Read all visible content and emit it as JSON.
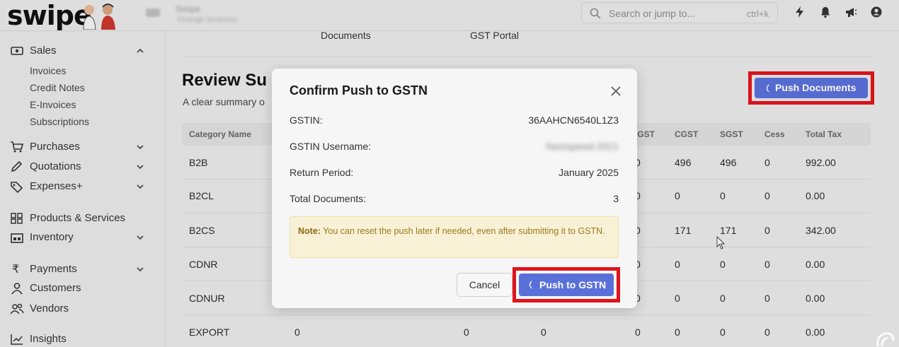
{
  "brand": {
    "logo_text": "swipe"
  },
  "topbar": {
    "company_name": "Swipe",
    "company_sub": "Change business",
    "search_placeholder": "Search or jump to...",
    "search_shortcut": "ctrl+k",
    "icons": [
      "lightning-icon",
      "bell-icon",
      "megaphone-icon",
      "user-circle-icon"
    ]
  },
  "sidebar": {
    "sales": "Sales",
    "sales_items": [
      "Invoices",
      "Credit Notes",
      "E-Invoices",
      "Subscriptions"
    ],
    "purchases": "Purchases",
    "quotations": "Quotations",
    "expenses": "Expenses+",
    "products": "Products & Services",
    "inventory": "Inventory",
    "payments": "Payments",
    "customers": "Customers",
    "vendors": "Vendors",
    "insights": "Insights"
  },
  "main": {
    "tabs": [
      "Documents",
      "GST Portal"
    ],
    "title": "Review Su",
    "subtitle": "A clear summary o",
    "push_documents_label": "Push Documents",
    "table": {
      "headers": [
        "Category Name",
        "IGST",
        "CGST",
        "SGST",
        "Cess",
        "Total Tax"
      ],
      "rows": [
        {
          "name": "B2B",
          "igst": "0",
          "cgst": "496",
          "sgst": "496",
          "cess": "0",
          "total": "992.00"
        },
        {
          "name": "B2CL",
          "igst": "0",
          "cgst": "0",
          "sgst": "0",
          "cess": "0",
          "total": "0.00"
        },
        {
          "name": "B2CS",
          "igst": "0",
          "cgst": "171",
          "sgst": "171",
          "cess": "0",
          "total": "342.00"
        },
        {
          "name": "CDNR",
          "igst": "0",
          "cgst": "0",
          "sgst": "0",
          "cess": "0",
          "total": "0.00"
        },
        {
          "name": "CDNUR",
          "igst": "0",
          "cgst": "0",
          "sgst": "0",
          "cess": "0",
          "total": "0.00"
        },
        {
          "name": "EXPORT",
          "c1": "0",
          "c2": "0",
          "c3": "0",
          "igst": "0",
          "cgst": "0",
          "sgst": "0",
          "cess": "0",
          "total": "0.00"
        }
      ]
    }
  },
  "modal": {
    "title": "Confirm Push to GSTN",
    "gstin_label": "GSTIN:",
    "gstin_value": "36AAHCN6540L1Z3",
    "username_label": "GSTIN Username:",
    "username_value": "Nextspeed-2021",
    "period_label": "Return Period:",
    "period_value": "January 2025",
    "docs_label": "Total Documents:",
    "docs_value": "3",
    "note_prefix": "Note:",
    "note_text": "You can reset the push later if needed, even after submitting it to GSTN.",
    "cancel_label": "Cancel",
    "push_label": "Push to GSTN"
  },
  "colors": {
    "primary": "#5a70d9",
    "highlight": "#e0141c",
    "note_bg": "#f8f1d6"
  }
}
